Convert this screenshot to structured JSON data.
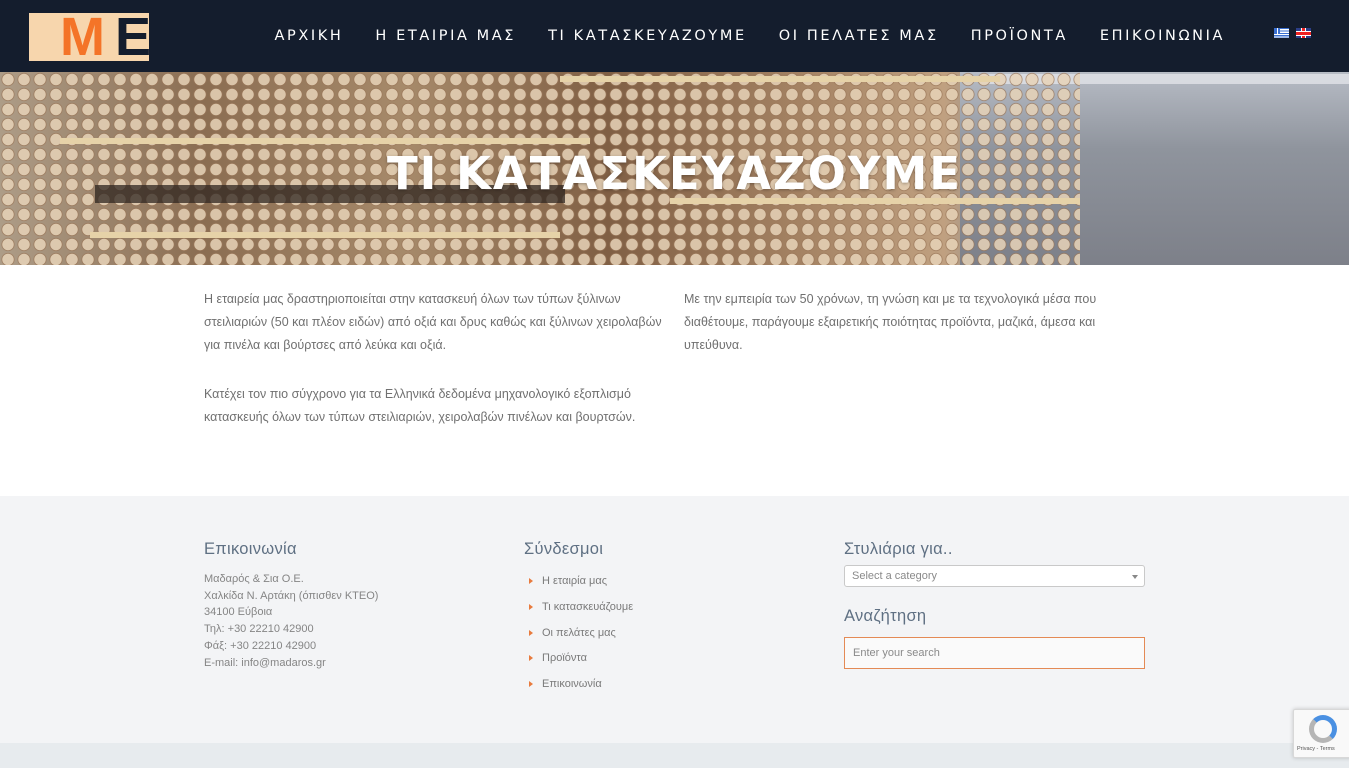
{
  "brand": {
    "logo_letters": [
      "M",
      "E"
    ],
    "colors": {
      "header_bg": "#141d2d",
      "logo_bg": "#f7d6ad",
      "accent": "#f47428",
      "footer_bg": "#f3f4f6"
    }
  },
  "nav": {
    "items": [
      {
        "label": "ΑΡΧΙΚΗ"
      },
      {
        "label": "Η ΕΤΑΙΡΙΑ ΜΑΣ"
      },
      {
        "label": "ΤΙ ΚΑΤΑΣΚΕΥΑΖΟΥΜΕ"
      },
      {
        "label": "ΟΙ ΠΕΛΑΤΕΣ ΜΑΣ"
      },
      {
        "label": "ΠΡΟΪΟΝΤΑ"
      },
      {
        "label": "ΕΠΙΚΟΙΝΩΝΙΑ"
      }
    ],
    "languages": [
      {
        "icon": "greek-flag-icon"
      },
      {
        "icon": "uk-flag-icon"
      }
    ]
  },
  "hero": {
    "title": "ΤΙ ΚΑΤΑΣΚΕΥΑΖΟΥΜΕ"
  },
  "content": {
    "left": [
      "Η εταιρεία μας δραστηριοποιείται στην κατασκευή όλων των τύπων ξύλινων στειλιαριών (50 και πλέον ειδών) από οξιά και δρυς καθώς και ξύλινων χειρολαβών για πινέλα και βούρτσες από λεύκα και οξιά.",
      "Κατέχει τον πιο σύγχρονο για τα Ελληνικά δεδομένα μηχανολογικό εξοπλισμό κατασκευής όλων των τύπων στειλιαριών, χειρολαβών πινέλων και βουρτσών."
    ],
    "right": [
      "Με την εμπειρία των 50 χρόνων, τη γνώση και με τα τεχνολογικά μέσα που διαθέτουμε, παράγουμε εξαιρετικής ποιότητας προϊόντα, μαζικά, άμεσα και υπεύθυνα."
    ]
  },
  "footer": {
    "contact": {
      "title": "Επικοινωνία",
      "lines": [
        "Μαδαρός & Σια Ο.Ε.",
        "Χαλκίδα Ν. Αρτάκη (όπισθεν ΚΤΕΟ)",
        "34100 Εύβοια",
        "Τηλ: +30 22210 42900",
        "Φάξ: +30 22210 42900",
        "E-mail: info@madaros.gr"
      ]
    },
    "links": {
      "title": "Σύνδεσμοι",
      "items": [
        {
          "label": "Η εταιρία μας"
        },
        {
          "label": "Τι κατασκευάζουμε"
        },
        {
          "label": "Οι πελάτες μας"
        },
        {
          "label": "Προϊόντα"
        },
        {
          "label": "Επικοινωνία"
        }
      ]
    },
    "categories": {
      "title": "Στυλιάρια για..",
      "select_value": "Select a category"
    },
    "search": {
      "title": "Αναζήτηση",
      "placeholder": "Enter your search"
    }
  },
  "recaptcha": {
    "text": "Privacy - Terms"
  }
}
